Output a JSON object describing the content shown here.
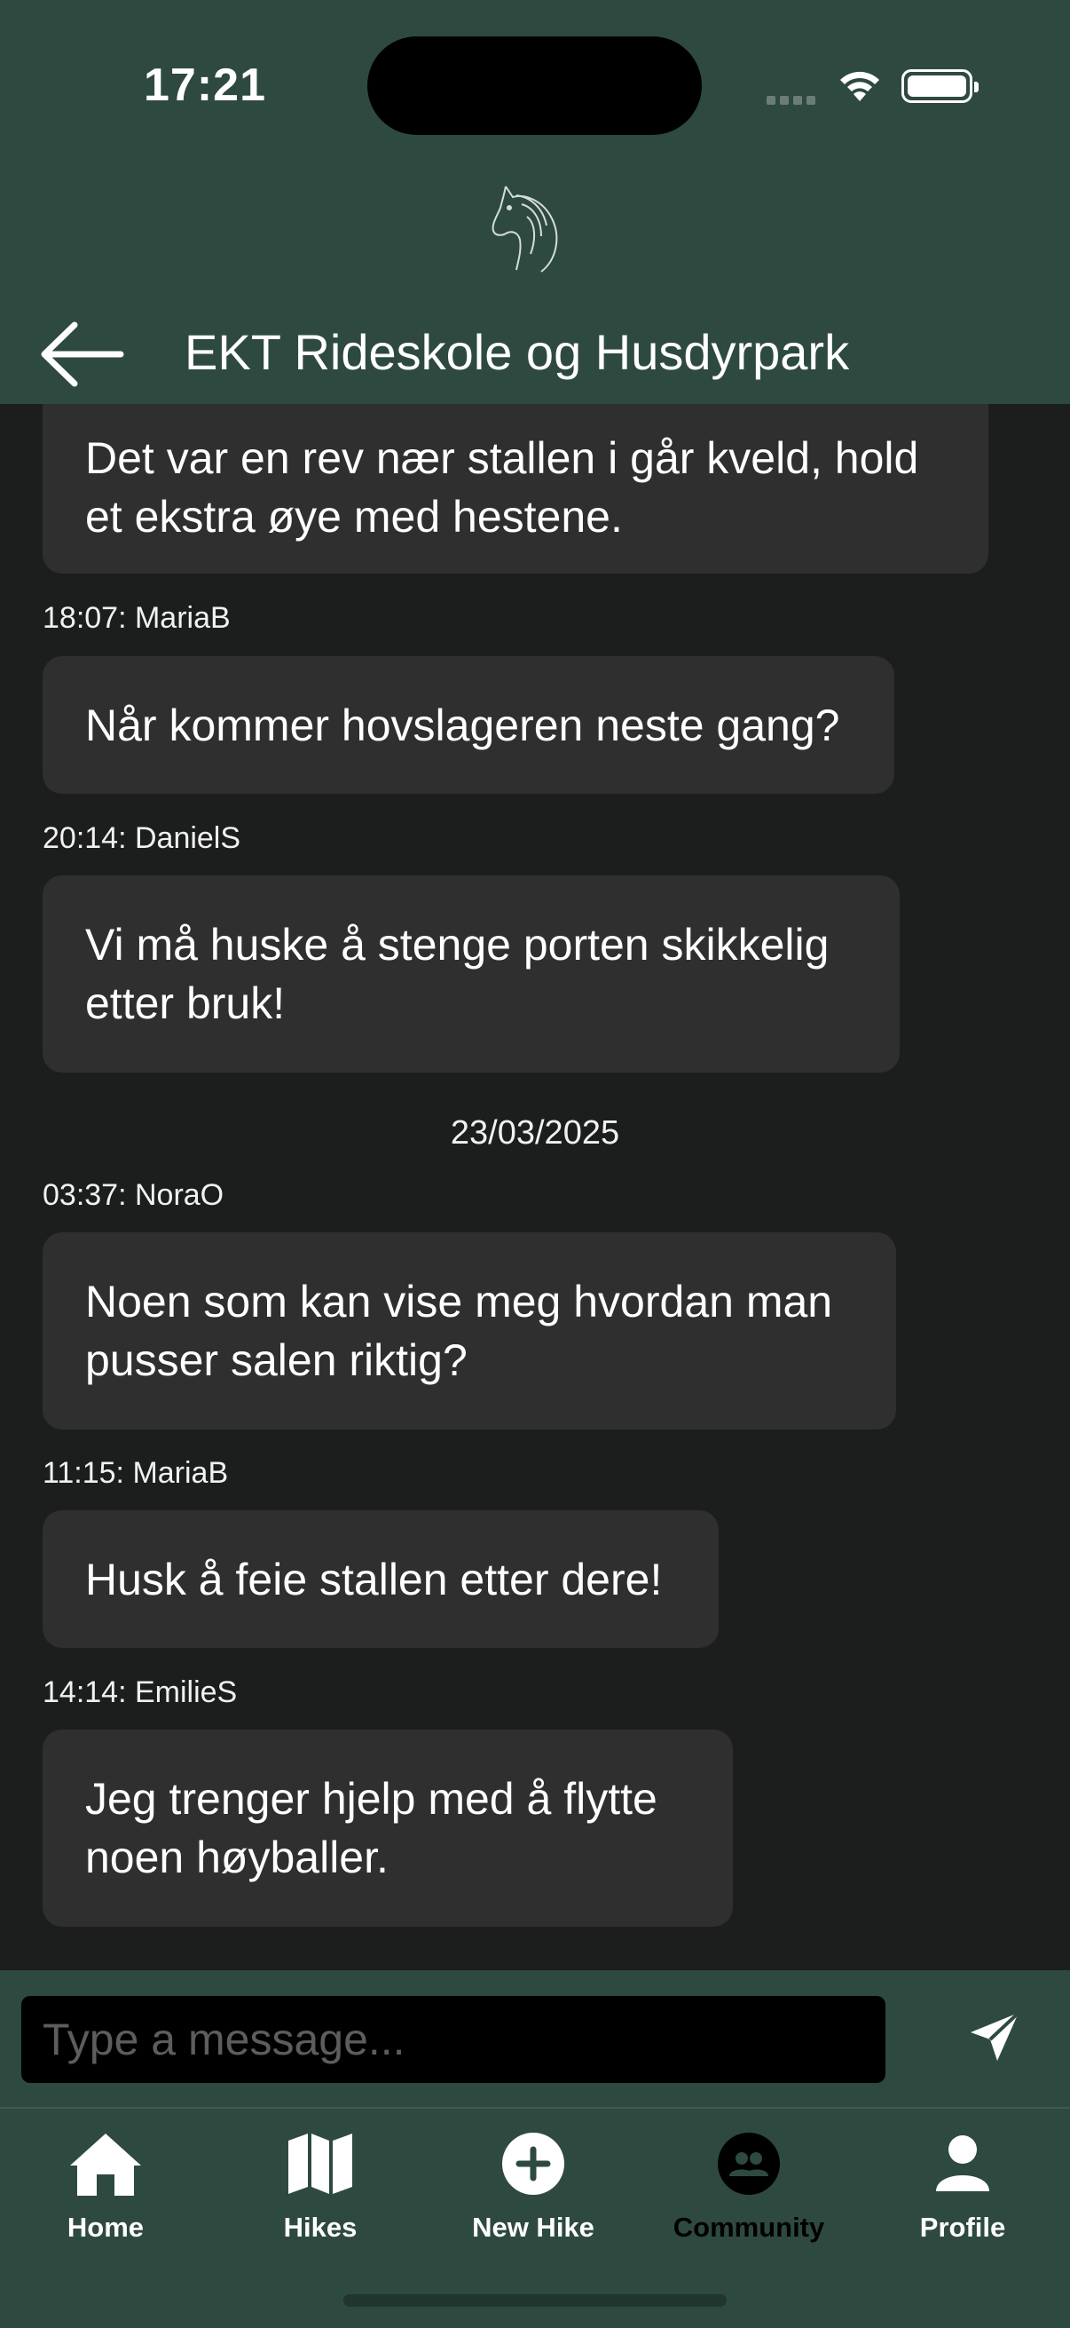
{
  "status_bar": {
    "time": "17:21"
  },
  "header": {
    "title": "EKT Rideskole og Husdyrpark",
    "logo_icon": "horse-head-icon",
    "back_icon": "arrow-left-icon"
  },
  "messages": [
    {
      "text": "Det var en rev nær stallen i går kveld, hold et ekstra øye med hestene."
    },
    {
      "meta": "18:07: MariaB",
      "text": "Når kommer hovslageren neste gang?"
    },
    {
      "meta": "20:14: DanielS",
      "text": "Vi må huske å stenge porten skikkelig etter bruk!"
    },
    {
      "meta": "03:37: NoraO",
      "text": "Noen som kan vise meg hvordan man pusser salen riktig?"
    },
    {
      "meta": "11:15: MariaB",
      "text": "Husk å feie stallen etter dere!"
    },
    {
      "meta": "14:14: EmilieS",
      "text": "Jeg trenger hjelp med å flytte noen høyballer."
    }
  ],
  "date_divider": "23/03/2025",
  "composer": {
    "placeholder": "Type a message...",
    "send_icon": "send-icon"
  },
  "tabs": [
    {
      "label": "Home",
      "icon": "home-icon"
    },
    {
      "label": "Hikes",
      "icon": "map-icon"
    },
    {
      "label": "New Hike",
      "icon": "plus-circle-icon"
    },
    {
      "label": "Community",
      "icon": "community-icon",
      "active": true
    },
    {
      "label": "Profile",
      "icon": "person-icon"
    }
  ],
  "colors": {
    "header": "#2e4a40",
    "background": "#1c1e1d",
    "bubble": "#2f2f2f",
    "active_tab": "#000000"
  }
}
